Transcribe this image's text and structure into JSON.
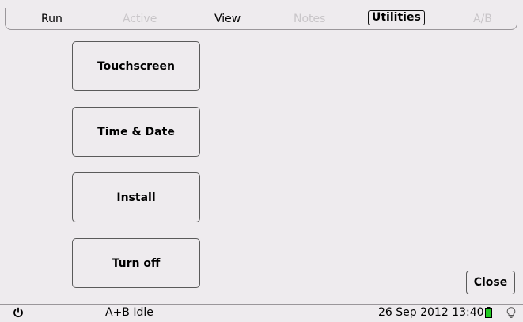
{
  "tabs": [
    {
      "label": "Run",
      "state": "enabled"
    },
    {
      "label": "Active",
      "state": "disabled"
    },
    {
      "label": "View",
      "state": "enabled"
    },
    {
      "label": "Notes",
      "state": "disabled"
    },
    {
      "label": "Utilities",
      "state": "selected"
    },
    {
      "label": "A/B",
      "state": "disabled"
    }
  ],
  "menu": {
    "touchscreen_label": "Touchscreen",
    "time_date_label": "Time & Date",
    "install_label": "Install",
    "turn_off_label": "Turn off"
  },
  "close_label": "Close",
  "status": {
    "power_icon": "power-icon",
    "state_text": "A+B Idle",
    "datetime": "26 Sep 2012 13:40",
    "battery_icon": "battery-icon",
    "bulb_icon": "lightbulb-icon"
  },
  "colors": {
    "background": "#eeebee",
    "disabled_text": "#c9c6c9",
    "battery_fill": "#22cc22"
  }
}
